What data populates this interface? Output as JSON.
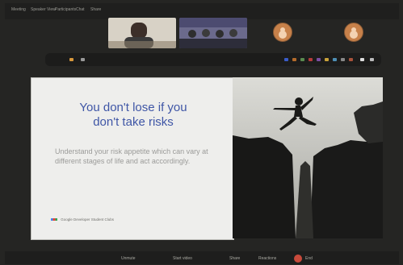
{
  "top_menu": [
    "Meeting",
    "Speaker View",
    "Participants",
    "Chat",
    "Share"
  ],
  "toolbar_text": "participant-controls",
  "slide": {
    "title_line1": "You don't lose if you",
    "title_line2": "don't take risks",
    "body": "Understand your risk appetite which can vary at different stages of life and act accordingly.",
    "footer": "Google Developer Student Clubs"
  },
  "bottom_controls": [
    "Unmute",
    "Start video",
    "Share",
    "Reactions",
    "End"
  ],
  "colors": {
    "accent_blue": "#3f56a6",
    "end_red": "#c84a3b"
  }
}
